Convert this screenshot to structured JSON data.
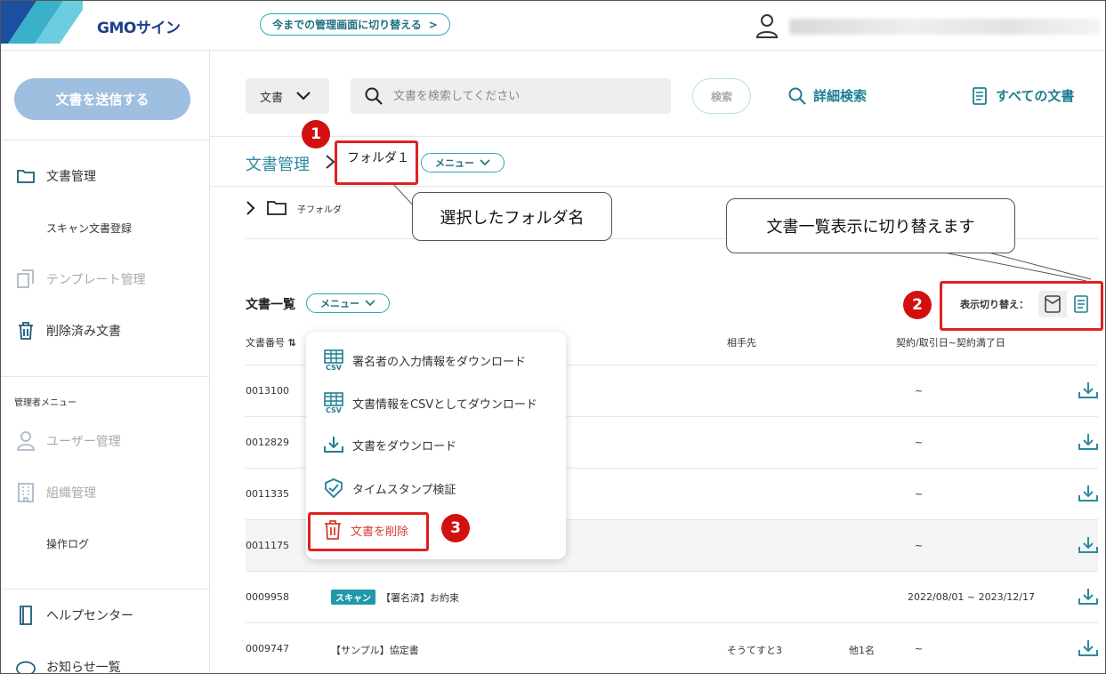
{
  "header": {
    "brand": "GMOサイン",
    "switch_label": "今までの管理画面に切り替える",
    "switch_chevron": ">"
  },
  "sidebar": {
    "send_button": "文書を送信する",
    "items": [
      {
        "label": "文書管理",
        "icon": "folder-icon"
      },
      {
        "label": "スキャン文書登録"
      },
      {
        "label": "テンプレート管理",
        "icon": "template-icon"
      },
      {
        "label": "削除済み文書",
        "icon": "trash-icon"
      }
    ],
    "admin_label": "管理者メニュー",
    "admin_items": [
      {
        "label": "ユーザー管理",
        "icon": "user-icon"
      },
      {
        "label": "組織管理",
        "icon": "building-icon"
      },
      {
        "label": "操作ログ"
      }
    ],
    "bottom_items": [
      {
        "label": "ヘルプセンター",
        "icon": "help-book-icon"
      },
      {
        "label": "お知らせ一覧",
        "icon": "notice-icon"
      }
    ]
  },
  "toolbar": {
    "doc_select": "文書",
    "search_placeholder": "文書を検索してください",
    "search_button": "検索",
    "advanced_search": "詳細検索",
    "all_docs": "すべての文書"
  },
  "breadcrumb": {
    "root": "文書管理",
    "separator": ">",
    "current": "フォルダ１",
    "menu_button": "メニュー"
  },
  "child_folder": "子フォルダ",
  "list": {
    "title": "文書一覧",
    "menu_button": "メニュー",
    "view_toggle_label": "表示切り替え：",
    "columns": {
      "doc_number": "文書番号",
      "partner": "相手先",
      "dates": "契約/取引日~契約満了日"
    },
    "rows": [
      {
        "number": "0013100",
        "title": "",
        "partner": "",
        "extra": "",
        "dates": "~"
      },
      {
        "number": "0012829",
        "title": "",
        "partner": "",
        "extra": "",
        "dates": "~"
      },
      {
        "number": "0011335",
        "title": "",
        "partner": "",
        "extra": "",
        "dates": "~"
      },
      {
        "number": "0011175",
        "title": "",
        "partner": "",
        "extra": "",
        "dates": "~"
      },
      {
        "number": "0009958",
        "badge": "スキャン",
        "title": "【署名済】お約束",
        "partner": "",
        "extra": "",
        "dates": "2022/08/01 ~ 2023/12/17"
      },
      {
        "number": "0009747",
        "title": "【サンプル】協定書",
        "partner": "そうてすと3",
        "extra": "他1名",
        "dates": "~"
      }
    ]
  },
  "dropdown": {
    "items": [
      {
        "label": "署名者の入力情報をダウンロード",
        "icon": "csv-icon"
      },
      {
        "label": "文書情報をCSVとしてダウンロード",
        "icon": "csv-icon"
      },
      {
        "label": "文書をダウンロード",
        "icon": "download-icon"
      },
      {
        "label": "タイムスタンプ検証",
        "icon": "shield-check-icon"
      },
      {
        "label": "文書を削除",
        "icon": "trash-icon"
      }
    ]
  },
  "annotations": {
    "step1": "1",
    "step2": "2",
    "step3": "3",
    "callout_folder": "選択したフォルダ名",
    "callout_view": "文書一覧表示に切り替えます"
  },
  "colors": {
    "accent": "#2fa6b8",
    "link": "#1e7f92",
    "annotation_red": "#e02020",
    "send_button": "#9ebfe0",
    "danger": "#d04030"
  }
}
